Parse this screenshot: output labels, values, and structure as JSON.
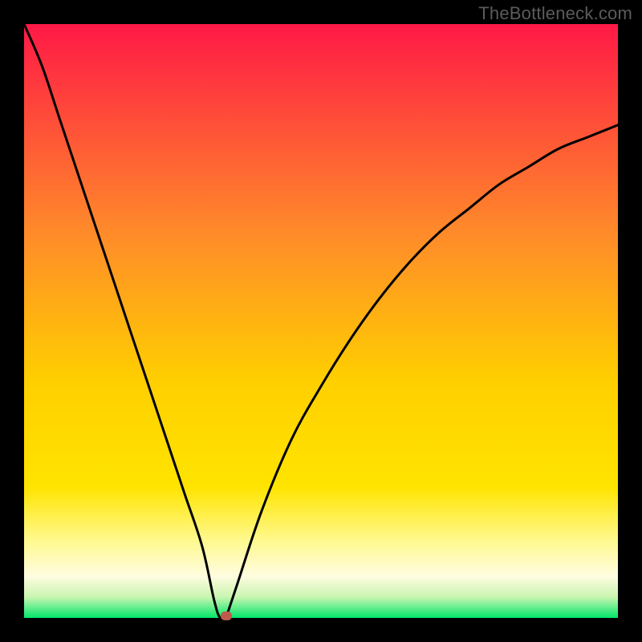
{
  "watermark": "TheBottleneck.com",
  "colors": {
    "black": "#000000",
    "grad_top": "#ff1946",
    "grad_orange": "#ff9526",
    "grad_yellow": "#ffe400",
    "grad_paleyellow": "#fffaa0",
    "grad_green": "#00e76a",
    "curve": "#000000",
    "marker": "#c05a4a"
  },
  "chart_data": {
    "type": "line",
    "title": "",
    "xlabel": "",
    "ylabel": "",
    "xlim": [
      0,
      100
    ],
    "ylim": [
      0,
      100
    ],
    "annotations": [
      {
        "text": "TheBottleneck.com",
        "position": "top-right"
      }
    ],
    "marker": {
      "x": 34,
      "y": 0
    },
    "series": [
      {
        "name": "left-branch",
        "x": [
          0,
          3,
          6,
          9,
          12,
          15,
          18,
          21,
          24,
          27,
          30,
          32,
          33,
          34
        ],
        "values": [
          100,
          93,
          84,
          75,
          66,
          57,
          48,
          39,
          30,
          21,
          12,
          3,
          0,
          0
        ]
      },
      {
        "name": "right-branch",
        "x": [
          34,
          36,
          40,
          45,
          50,
          55,
          60,
          65,
          70,
          75,
          80,
          85,
          90,
          95,
          100
        ],
        "values": [
          0,
          6,
          18,
          30,
          39,
          47,
          54,
          60,
          65,
          69,
          73,
          76,
          79,
          81,
          83
        ]
      }
    ]
  }
}
